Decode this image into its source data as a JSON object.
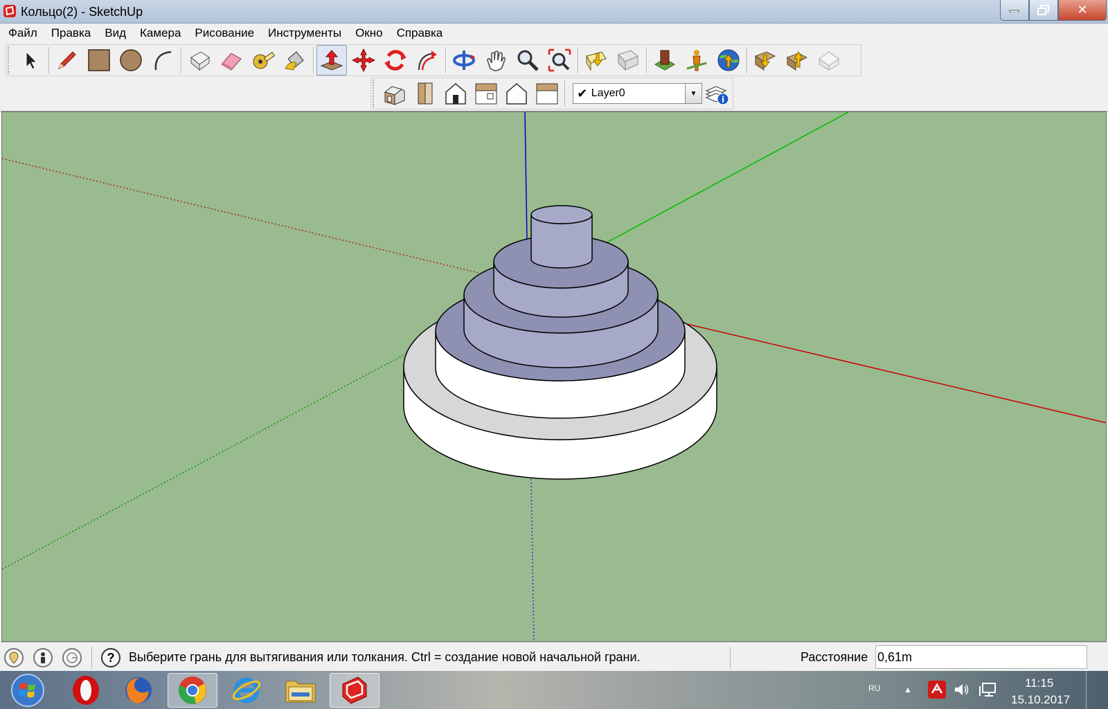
{
  "window": {
    "title": "Кольцо(2) - SketchUp"
  },
  "menu": [
    "Файл",
    "Правка",
    "Вид",
    "Камера",
    "Рисование",
    "Инструменты",
    "Окно",
    "Справка"
  ],
  "layer": {
    "current": "Layer0",
    "visible": true
  },
  "status": {
    "hint": "Выберите грань для вытягивания или толкания.  Ctrl = создание новой начальной грани.",
    "measurement_label": "Расстояние",
    "measurement_value": "0,61m"
  },
  "taskbar": {
    "apps": [
      "start-orb",
      "opera",
      "firefox",
      "chrome",
      "internet-explorer",
      "file-explorer",
      "sketchup"
    ],
    "active_app": "sketchup",
    "language": "RU",
    "time": "11:15",
    "date": "15.10.2017"
  },
  "colors": {
    "viewport_background": "#99bb8f",
    "face_front": "#ffffff",
    "face_back": "#a6a9c8",
    "axis_red": "#cc0000",
    "axis_green": "#00bb00",
    "axis_blue": "#0000cc"
  },
  "active_tool": "push-pull-tool"
}
